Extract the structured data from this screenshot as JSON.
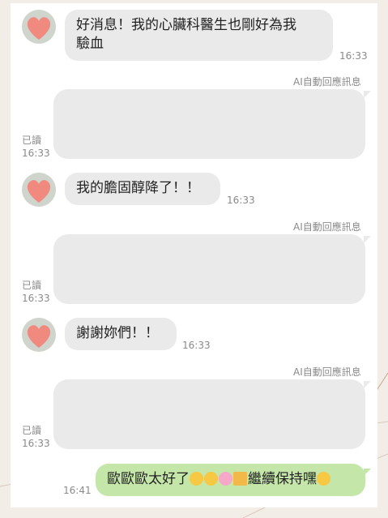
{
  "messages": [
    {
      "text_line1": "好消息！我的心臟科醫生也剛好為我",
      "text_line2": "驗血",
      "time": "16:33"
    },
    {
      "text": "我的膽固醇降了！！",
      "time": "16:33"
    },
    {
      "text": "謝謝妳們！！",
      "time": "16:33"
    }
  ],
  "replies": [
    {
      "tag": "AI自動回應訊息",
      "read": "已讀",
      "time": "16:33"
    },
    {
      "tag": "AI自動回應訊息",
      "read": "已讀",
      "time": "16:33"
    },
    {
      "tag": "AI自動回應訊息",
      "read": "已讀",
      "time": "16:33"
    }
  ],
  "outgoing": {
    "text": "歐歐歐太好了",
    "text_after": "繼續保持嘿",
    "time": "16:41",
    "emojis": [
      "grinning-squint-face",
      "grinning-squint-face",
      "cherry-blossom",
      "party-popper",
      "smiling-face-with-hearts"
    ]
  },
  "colors": {
    "incoming_bubble": "#eaeaea",
    "outgoing_bubble": "#c4e6a8",
    "avatar_heart": "#f08a7e"
  }
}
